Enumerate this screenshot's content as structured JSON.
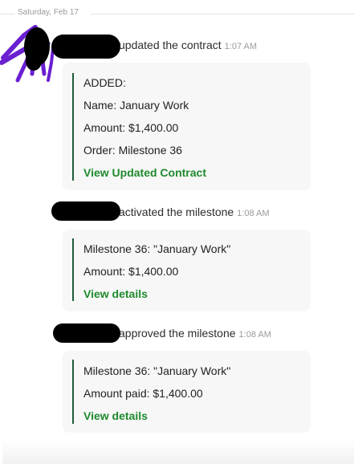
{
  "date_divider": {
    "label": "Saturday, Feb 17"
  },
  "events": [
    {
      "action": "updated the contract",
      "time": "1:07 AM",
      "lines": [
        "ADDED:",
        "Name: January Work",
        "Amount: $1,400.00",
        "Order: Milestone 36"
      ],
      "link": "View Updated Contract"
    },
    {
      "action": "activated the milestone",
      "time": "1:08 AM",
      "lines": [
        "Milestone 36: \"January Work\"",
        "Amount: $1,400.00"
      ],
      "link": "View details"
    },
    {
      "action": "approved the milestone",
      "time": "1:08 AM",
      "lines": [
        "Milestone 36: \"January Work\"",
        "Amount paid: $1,400.00"
      ],
      "link": "View details"
    }
  ],
  "colors": {
    "link": "#1f8a2e",
    "quote_bar": "#1f5c3a",
    "card_bg": "#f6f7f6",
    "scribble_purple": "#6a1fd1"
  }
}
